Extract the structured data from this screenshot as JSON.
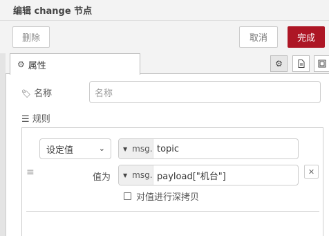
{
  "dialog": {
    "title": "编辑 change 节点"
  },
  "toolbar": {
    "delete_label": "删除",
    "cancel_label": "取消",
    "done_label": "完成"
  },
  "tabs": {
    "properties_label": "属性"
  },
  "form": {
    "name_label": "名称",
    "name_placeholder": "名称",
    "rules_label": "规则"
  },
  "rule": {
    "action_selected": "设定值",
    "property_type": "msg.",
    "property_value": "topic",
    "to_label": "值为",
    "value_type": "msg.",
    "value_value": "payload[\"机台\"]",
    "deepcopy_label": "对值进行深拷贝",
    "deepcopy_checked": false
  },
  "colors": {
    "accent": "#ad1625"
  }
}
